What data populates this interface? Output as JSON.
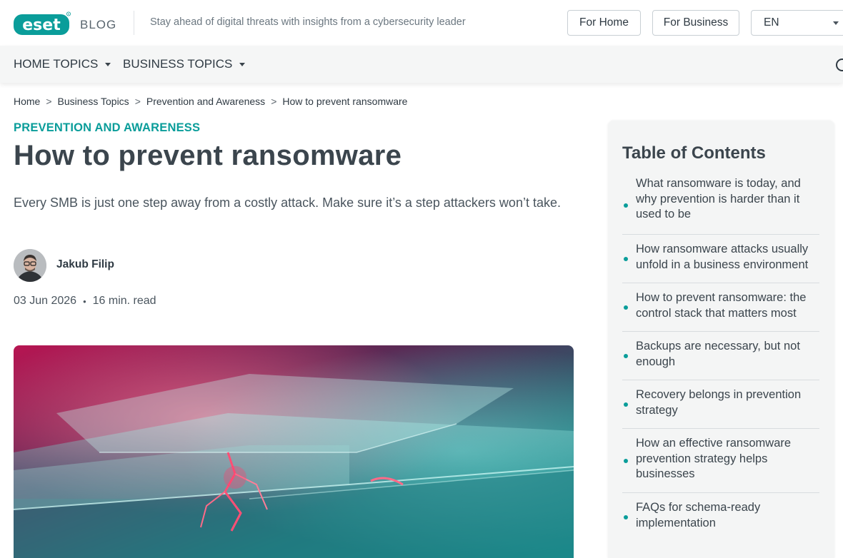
{
  "header": {
    "logo_text": "eset",
    "blog_label": "BLOG",
    "tagline": "Stay ahead of digital threats with insights from a cybersecurity leader",
    "for_home": "For Home",
    "for_business": "For Business",
    "language": "EN"
  },
  "nav": {
    "home_topics": "HOME TOPICS",
    "business_topics": "BUSINESS TOPICS"
  },
  "breadcrumb": [
    "Home",
    "Business Topics",
    "Prevention and Awareness",
    "How to prevent ransomware"
  ],
  "breadcrumb_separator": ">",
  "article": {
    "category": "PREVENTION AND AWARENESS",
    "title": "How to prevent ransomware",
    "subtitle": "Every SMB is just one step away from a costly attack. Make sure it’s a step attackers won’t take.",
    "author": "Jakub Filip",
    "date": "03 Jun 2026",
    "meta_separator": "•",
    "read_time": "16 min. read"
  },
  "toc": {
    "title": "Table of Contents",
    "items": [
      "What ransomware is today, and why prevention is harder than it used to be",
      "How ransomware attacks usually unfold in a business environment",
      "How to prevent ransomware: the control stack that matters most",
      "Backups are necessary, but not enough",
      "Recovery belongs in prevention strategy",
      "How an effective ransomware prevention strategy helps businesses",
      "FAQs for schema-ready implementation"
    ]
  },
  "colors": {
    "brand_teal": "#0a9d9a",
    "text_dark": "#3b454d",
    "nav_bg": "#f5f6f6",
    "toc_bg": "#f4f5f5"
  },
  "icons": [
    "eset-logo",
    "search-icon",
    "chevron-down-icon",
    "bullet-icon"
  ]
}
